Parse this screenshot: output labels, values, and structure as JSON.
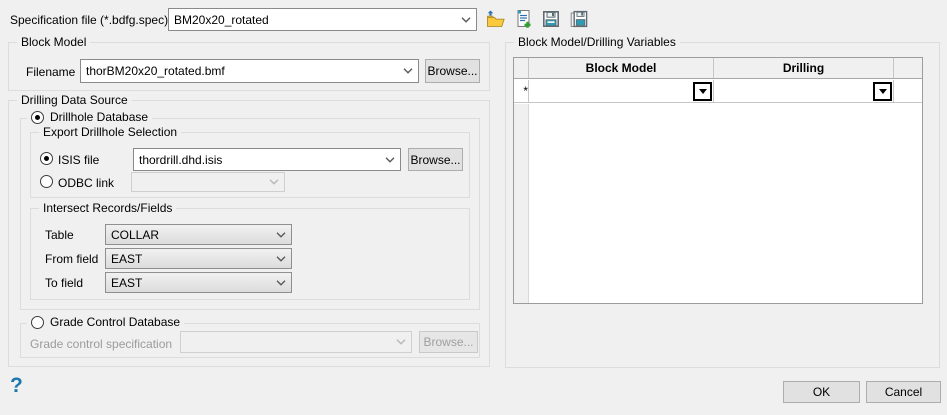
{
  "colors": {
    "dialog_background": "#f0f0f0",
    "help_icon_blue": "#1a78ad",
    "folder_icon_yellow": "#fbc93d",
    "save_icon_teal": "#2e9bb5",
    "new_icon_green": "#2ea12e"
  },
  "spec_file": {
    "label": "Specification file (*.bdfg.spec)",
    "value": "BM20x20_rotated",
    "icons": [
      "open-folder-icon",
      "new-spec-icon",
      "save-icon",
      "save-as-icon"
    ]
  },
  "block_model": {
    "title": "Block Model",
    "filename_label": "Filename",
    "filename_value": "thorBM20x20_rotated.bmf",
    "browse_label": "Browse..."
  },
  "drilling_data_source": {
    "title": "Drilling Data Source",
    "drillhole_database": {
      "label": "Drillhole Database",
      "selected": true,
      "export_selection": {
        "title": "Export Drillhole Selection",
        "isis_file_label": "ISIS file",
        "isis_file_selected": true,
        "isis_file_value": "thordrill.dhd.isis",
        "isis_browse_label": "Browse...",
        "odbc_link_label": "ODBC link",
        "odbc_link_selected": false,
        "odbc_link_value": ""
      },
      "intersect": {
        "title": "Intersect Records/Fields",
        "rows": [
          {
            "label": "Table",
            "value": "COLLAR"
          },
          {
            "label": "From field",
            "value": "EAST"
          },
          {
            "label": "To field",
            "value": "EAST"
          }
        ]
      }
    },
    "grade_control": {
      "label": "Grade Control Database",
      "selected": false,
      "spec_label": "Grade control specification",
      "spec_value": "",
      "browse_label": "Browse..."
    }
  },
  "variables_panel": {
    "title": "Block Model/Drilling Variables",
    "columns": [
      "Block Model",
      "Drilling"
    ],
    "new_row_marker": "*",
    "rows": [
      {
        "block_model": "",
        "drilling": ""
      }
    ]
  },
  "footer": {
    "help": "?",
    "ok": "OK",
    "cancel": "Cancel"
  }
}
